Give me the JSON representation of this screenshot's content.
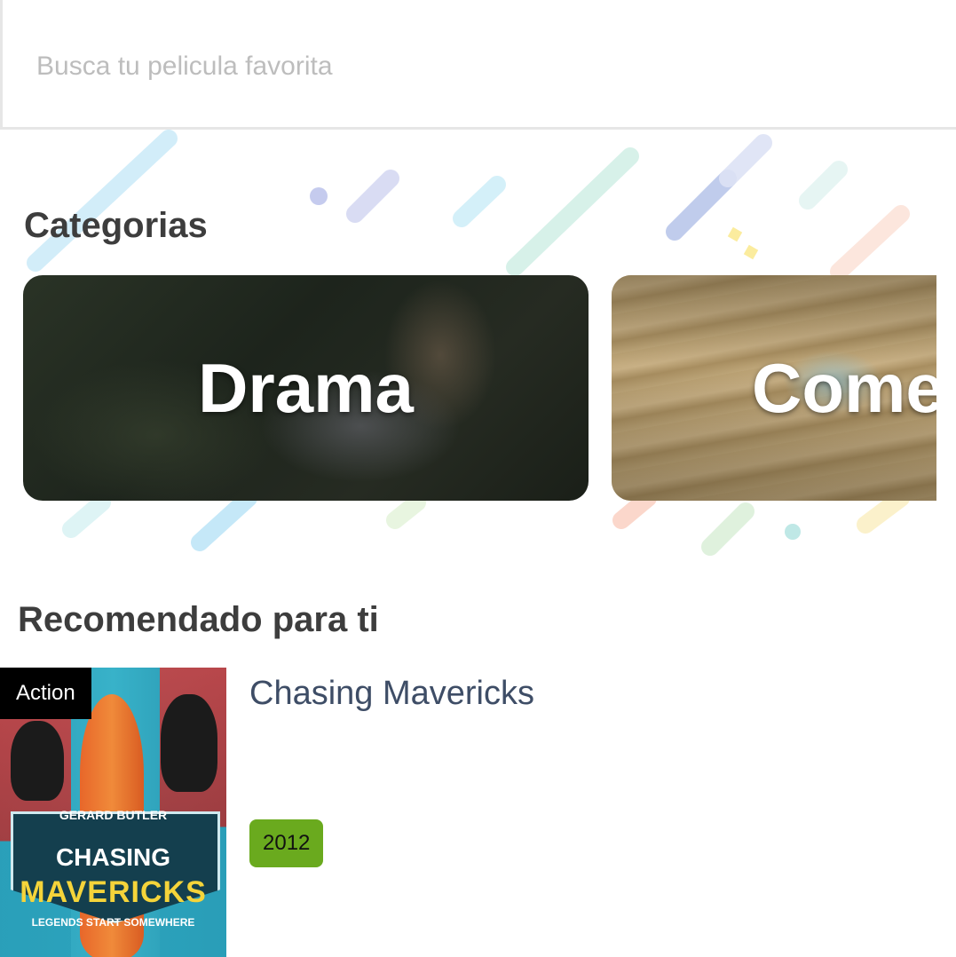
{
  "search": {
    "placeholder": "Busca tu pelicula favorita",
    "value": ""
  },
  "categories": {
    "title": "Categorias",
    "items": [
      {
        "label": "Drama"
      },
      {
        "label": "Comedia"
      }
    ]
  },
  "recommended": {
    "title": "Recomendado para ti",
    "items": [
      {
        "title": "Chasing Mavericks",
        "genre": "Action",
        "year": "2012",
        "poster": {
          "top_credit": "GERARD BUTLER",
          "title_line1": "CHASING",
          "title_line2": "MAVERICKS",
          "tagline": "LEGENDS START SOMEWHERE"
        }
      }
    ]
  },
  "colors": {
    "year_badge": "#6aaa1e",
    "title_text": "#3e4d66",
    "heading_text": "#3d3d3d"
  }
}
